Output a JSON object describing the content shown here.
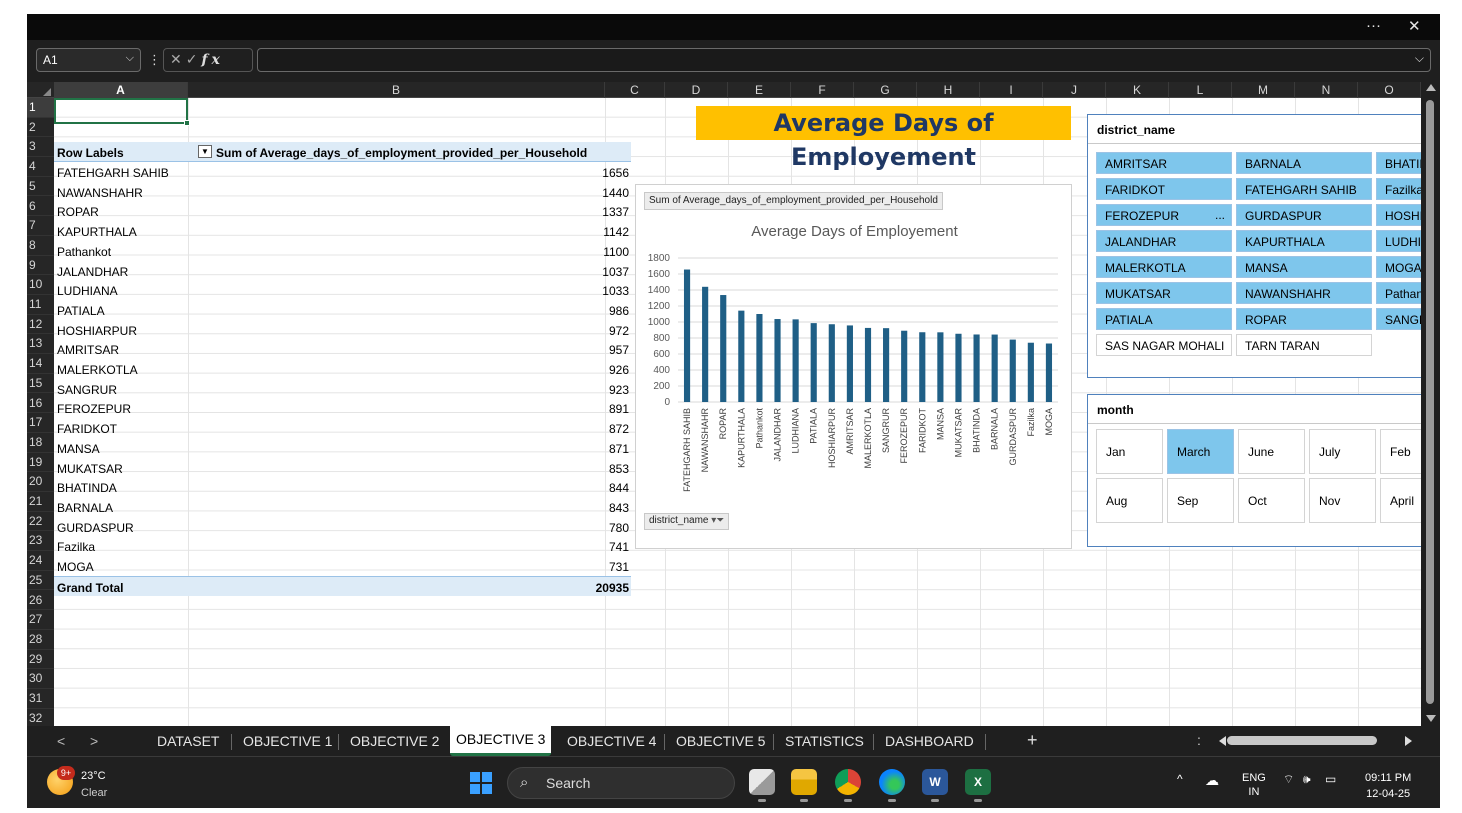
{
  "window": {
    "more_icon": "more-icon",
    "more_glyph": "···",
    "close_icon": "close-icon",
    "close_glyph": "✕"
  },
  "formula_bar": {
    "name_box": "A1",
    "formula": ""
  },
  "columns": [
    "A",
    "B",
    "C",
    "D",
    "E",
    "F",
    "G",
    "H",
    "I",
    "J",
    "K",
    "L",
    "M",
    "N",
    "O"
  ],
  "rows": [
    "1",
    "2",
    "3",
    "4",
    "5",
    "6",
    "7",
    "8",
    "9",
    "10",
    "11",
    "12",
    "13",
    "14",
    "15",
    "16",
    "17",
    "18",
    "19",
    "20",
    "21",
    "22",
    "23",
    "24",
    "25",
    "26",
    "27",
    "28",
    "29",
    "30",
    "31",
    "32"
  ],
  "pivot": {
    "row_labels_header": "Row Labels",
    "value_header": "Sum of Average_days_of_employment_provided_per_Household",
    "rows": [
      {
        "name": "FATEHGARH SAHIB",
        "value": "1656"
      },
      {
        "name": "NAWANSHAHR",
        "value": "1440"
      },
      {
        "name": "ROPAR",
        "value": "1337"
      },
      {
        "name": "KAPURTHALA",
        "value": "1142"
      },
      {
        "name": "Pathankot",
        "value": "1100"
      },
      {
        "name": "JALANDHAR",
        "value": "1037"
      },
      {
        "name": "LUDHIANA",
        "value": "1033"
      },
      {
        "name": "PATIALA",
        "value": "986"
      },
      {
        "name": "HOSHIARPUR",
        "value": "972"
      },
      {
        "name": "AMRITSAR",
        "value": "957"
      },
      {
        "name": "MALERKOTLA",
        "value": "926"
      },
      {
        "name": "SANGRUR",
        "value": "923"
      },
      {
        "name": "FEROZEPUR",
        "value": "891"
      },
      {
        "name": "FARIDKOT",
        "value": "872"
      },
      {
        "name": "MANSA",
        "value": "871"
      },
      {
        "name": "MUKATSAR",
        "value": "853"
      },
      {
        "name": "BHATINDA",
        "value": "844"
      },
      {
        "name": "BARNALA",
        "value": "843"
      },
      {
        "name": "GURDASPUR",
        "value": "780"
      },
      {
        "name": "Fazilka",
        "value": "741"
      },
      {
        "name": "MOGA",
        "value": "731"
      }
    ],
    "grand_total_label": "Grand Total",
    "grand_total_value": "20935"
  },
  "banner_title": "Average Days of Employement",
  "chart_data": {
    "type": "bar",
    "field_button": "Sum of Average_days_of_employment_provided_per_Household",
    "title": "Average Days of Employement",
    "axis_field_button": "district_name",
    "categories": [
      "FATEHGARH SAHIB",
      "NAWANSHAHR",
      "ROPAR",
      "KAPURTHALA",
      "Pathankot",
      "JALANDHAR",
      "LUDHIANA",
      "PATIALA",
      "HOSHIARPUR",
      "AMRITSAR",
      "MALERKOTLA",
      "SANGRUR",
      "FEROZEPUR",
      "FARIDKOT",
      "MANSA",
      "MUKATSAR",
      "BHATINDA",
      "BARNALA",
      "GURDASPUR",
      "Fazilka",
      "MOGA"
    ],
    "values": [
      1656,
      1440,
      1337,
      1142,
      1100,
      1037,
      1033,
      986,
      972,
      957,
      926,
      923,
      891,
      872,
      871,
      853,
      844,
      843,
      780,
      741,
      731
    ],
    "ylim": [
      0,
      1800
    ],
    "yticks": [
      0,
      200,
      400,
      600,
      800,
      1000,
      1200,
      1400,
      1600,
      1800
    ],
    "grid": true,
    "bar_color": "#1f5f86"
  },
  "slicer_district": {
    "title": "district_name",
    "items": [
      {
        "label": "AMRITSAR",
        "selected": true
      },
      {
        "label": "BARNALA",
        "selected": true
      },
      {
        "label": "BHATINDA",
        "selected": true
      },
      {
        "label": "FARIDKOT",
        "selected": true
      },
      {
        "label": "FATEHGARH SAHIB",
        "selected": true
      },
      {
        "label": "Fazilka",
        "selected": true
      },
      {
        "label": "FEROZEPUR",
        "selected": true
      },
      {
        "label": "GURDASPUR",
        "selected": true
      },
      {
        "label": "HOSHIARPUR",
        "selected": true
      },
      {
        "label": "JALANDHAR",
        "selected": true
      },
      {
        "label": "KAPURTHALA",
        "selected": true
      },
      {
        "label": "LUDHIANA",
        "selected": true
      },
      {
        "label": "MALERKOTLA",
        "selected": true
      },
      {
        "label": "MANSA",
        "selected": true
      },
      {
        "label": "MOGA",
        "selected": true
      },
      {
        "label": "MUKATSAR",
        "selected": true
      },
      {
        "label": "NAWANSHAHR",
        "selected": true
      },
      {
        "label": "Pathankot",
        "selected": true
      },
      {
        "label": "PATIALA",
        "selected": true
      },
      {
        "label": "ROPAR",
        "selected": true
      },
      {
        "label": "SANGRUR",
        "selected": true
      },
      {
        "label": "SAS NAGAR MOHALI",
        "selected": false
      },
      {
        "label": "TARN TARAN",
        "selected": false
      }
    ],
    "ellipsis": "..."
  },
  "slicer_month": {
    "title": "month",
    "items": [
      {
        "label": "Jan",
        "selected": false
      },
      {
        "label": "March",
        "selected": true
      },
      {
        "label": "June",
        "selected": false
      },
      {
        "label": "July",
        "selected": false
      },
      {
        "label": "Feb",
        "selected": false
      },
      {
        "label": "Aug",
        "selected": false
      },
      {
        "label": "Sep",
        "selected": false
      },
      {
        "label": "Oct",
        "selected": false
      },
      {
        "label": "Nov",
        "selected": false
      },
      {
        "label": "April",
        "selected": false
      }
    ]
  },
  "sheet_tabs": {
    "tabs": [
      "DATASET",
      "OBJECTIVE 1",
      "OBJECTIVE 2",
      "OBJECTIVE 3",
      "OBJECTIVE 4",
      "OBJECTIVE 5",
      "STATISTICS",
      "DASHBOARD"
    ],
    "active": "OBJECTIVE 3",
    "add": "+",
    "prev": "<",
    "next": ">",
    "more": ":"
  },
  "taskbar": {
    "weather_badge": "9+",
    "temperature": "23°C",
    "weather_status": "Clear",
    "search_placeholder": "Search",
    "language": "ENG",
    "region": "IN",
    "time": "09:11 PM",
    "date": "12-04-25",
    "apps": [
      "file-explorer-icon",
      "files-icon",
      "chrome-icon",
      "edge-icon",
      "word-icon",
      "excel-icon"
    ],
    "colors": {
      "accent": "#217346",
      "pivot_header": "#ddebf7",
      "banner": "#ffc000",
      "slicer_selected": "#7ec6ec"
    }
  }
}
